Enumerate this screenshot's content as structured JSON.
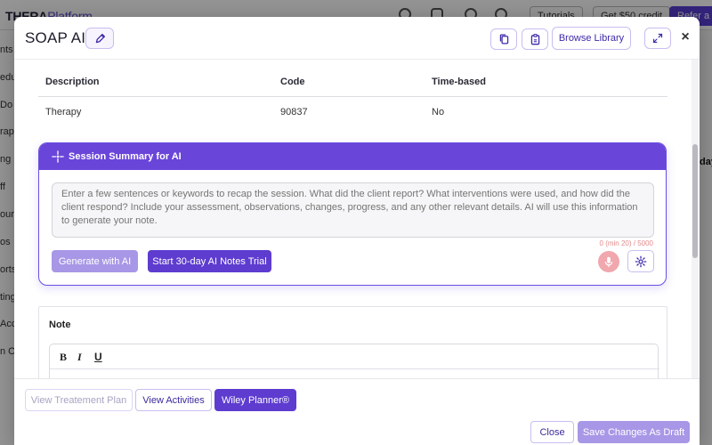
{
  "background": {
    "logo_part1": "THERA",
    "logo_part2": "Platform",
    "btn_tutorials": "Tutorials",
    "btn_credit": "Get $50 credit",
    "btn_refer": "Refer a F",
    "right_text": "day",
    "sidebar_items": [
      "nts",
      "edu",
      "Do",
      "rap",
      "ng",
      "ff",
      "our",
      "os",
      "orts",
      "ting",
      "Acc",
      "n Ou"
    ]
  },
  "modal": {
    "title": "SOAP AI",
    "browse_library": "Browse Library",
    "close_symbol": "×"
  },
  "table": {
    "headers": [
      "Description",
      "Code",
      "Time-based"
    ],
    "rows": [
      [
        "Therapy",
        "90837",
        "No"
      ]
    ]
  },
  "ai_summary": {
    "title": "Session Summary for AI",
    "placeholder": "Enter a few sentences or keywords to recap the session. What did the client report? What interventions were used, and how did the client respond? Include your assessment, observations, changes, progress, and any other relevant details. AI will use this information to generate your note.",
    "char_count": "0 (min 20) / 5000",
    "generate_label": "Generate with AI",
    "trial_label": "Start 30-day AI Notes Trial"
  },
  "note": {
    "label": "Note",
    "toolbar": {
      "bold": "B",
      "italic": "I",
      "underline": "U"
    }
  },
  "footer": {
    "tabs": [
      "View Treatement Plan",
      "View Activities",
      "Wiley Planner®"
    ],
    "close_label": "Close",
    "save_label": "Save Changes As Draft"
  },
  "colors": {
    "accent": "#5e3ccf",
    "accent_light": "#a897e6",
    "header_purple": "#6a45da"
  }
}
